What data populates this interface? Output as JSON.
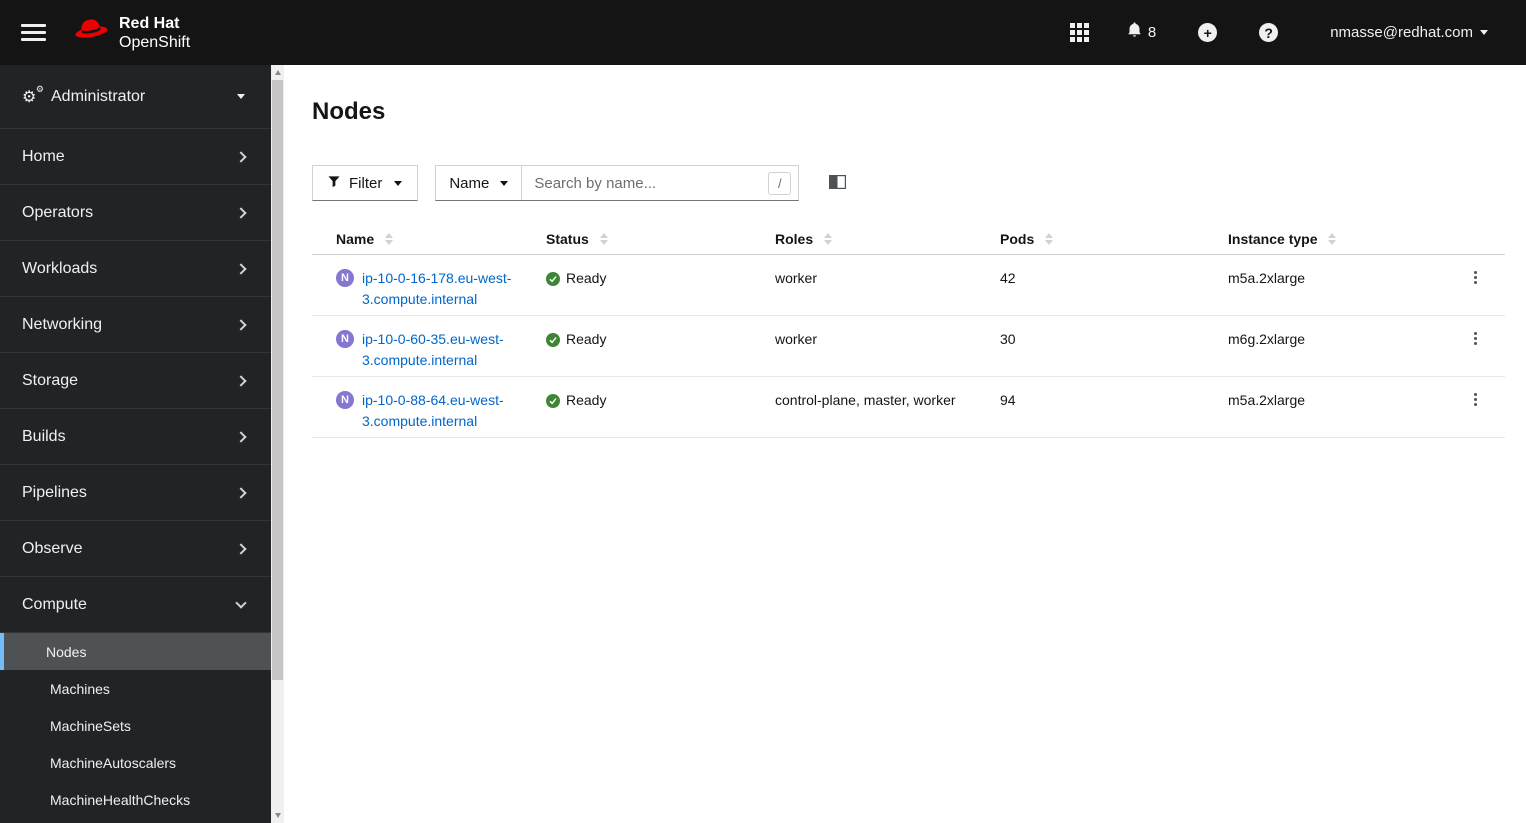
{
  "masthead": {
    "brand_line1": "Red Hat",
    "brand_line2": "OpenShift",
    "notification_count": "8",
    "user": "nmasse@redhat.com"
  },
  "sidebar": {
    "perspective": "Administrator",
    "items": [
      {
        "label": "Home"
      },
      {
        "label": "Operators"
      },
      {
        "label": "Workloads"
      },
      {
        "label": "Networking"
      },
      {
        "label": "Storage"
      },
      {
        "label": "Builds"
      },
      {
        "label": "Pipelines"
      },
      {
        "label": "Observe"
      }
    ],
    "compute_label": "Compute",
    "compute_children": [
      {
        "label": "Nodes",
        "current": true
      },
      {
        "label": "Machines"
      },
      {
        "label": "MachineSets"
      },
      {
        "label": "MachineAutoscalers"
      },
      {
        "label": "MachineHealthChecks"
      }
    ]
  },
  "page": {
    "title": "Nodes",
    "toolbar": {
      "filter_label": "Filter",
      "search_attribute": "Name",
      "search_placeholder": "Search by name...",
      "search_value": "",
      "shortcut_hint": "/"
    },
    "table": {
      "columns": [
        "Name",
        "Status",
        "Roles",
        "Pods",
        "Instance type"
      ],
      "rows": [
        {
          "badge": "N",
          "name": "ip-10-0-16-178.eu-west-3.compute.internal",
          "status": "Ready",
          "roles": "worker",
          "pods": "42",
          "instance_type": "m5a.2xlarge"
        },
        {
          "badge": "N",
          "name": "ip-10-0-60-35.eu-west-3.compute.internal",
          "status": "Ready",
          "roles": "worker",
          "pods": "30",
          "instance_type": "m6g.2xlarge"
        },
        {
          "badge": "N",
          "name": "ip-10-0-88-64.eu-west-3.compute.internal",
          "status": "Ready",
          "roles": "control-plane, master, worker",
          "pods": "94",
          "instance_type": "m5a.2xlarge"
        }
      ]
    }
  },
  "colors": {
    "brand_red": "#ee0000",
    "masthead_bg": "#141414",
    "sidebar_bg": "#212427",
    "link_blue": "#0066cc",
    "success_green": "#3e8635",
    "node_badge_purple": "#8476d1",
    "nav_current_blue": "#73bcf7"
  }
}
